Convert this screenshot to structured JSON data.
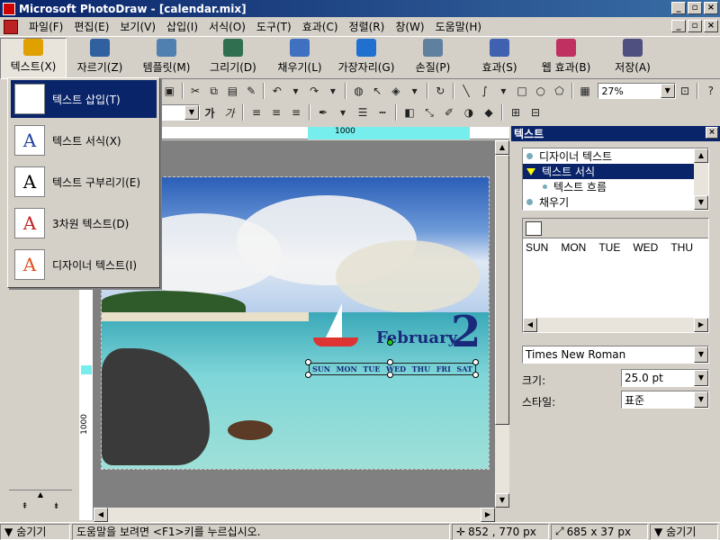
{
  "window": {
    "title": "Microsoft PhotoDraw - [calendar.mix]",
    "min": "_",
    "max": "▫",
    "close": "×"
  },
  "menubar": {
    "items": [
      "파일(F)",
      "편집(E)",
      "보기(V)",
      "삽입(I)",
      "서식(O)",
      "도구(T)",
      "효과(C)",
      "정렬(R)",
      "창(W)",
      "도움말(H)"
    ]
  },
  "bigbar": {
    "items": [
      {
        "label": "텍스트(X)",
        "icon": "text-icon",
        "color": "#e0a000"
      },
      {
        "label": "자르기(Z)",
        "icon": "crop-icon",
        "color": "#3060a0"
      },
      {
        "label": "템플릿(M)",
        "icon": "template-icon",
        "color": "#5080b0"
      },
      {
        "label": "그리기(D)",
        "icon": "draw-icon",
        "color": "#307050"
      },
      {
        "label": "채우기(L)",
        "icon": "fill-icon",
        "color": "#4070c0"
      },
      {
        "label": "가장자리(G)",
        "icon": "edge-icon",
        "color": "#2070d0"
      },
      {
        "label": "손질(P)",
        "icon": "touchup-icon",
        "color": "#6080a0"
      },
      {
        "label": "효과(S)",
        "icon": "effects-icon",
        "color": "#4060b0"
      },
      {
        "label": "웹 효과(B)",
        "icon": "web-effects-icon",
        "color": "#c03060"
      },
      {
        "label": "저장(A)",
        "icon": "save-icon",
        "color": "#505080"
      }
    ]
  },
  "toolbar": {
    "zoom": "27%"
  },
  "textmenu": {
    "items": [
      {
        "label": "텍스트 삽입(T)",
        "icon": "insert-text-icon",
        "glyph": "A"
      },
      {
        "label": "텍스트 서식(X)",
        "icon": "format-text-icon",
        "glyph": "A"
      },
      {
        "label": "텍스트 구부리기(E)",
        "icon": "bend-text-icon",
        "glyph": "A"
      },
      {
        "label": "3차원 텍스트(D)",
        "icon": "3d-text-icon",
        "glyph": "A"
      },
      {
        "label": "디자이너 텍스트(I)",
        "icon": "designer-text-icon",
        "glyph": "A"
      }
    ]
  },
  "ruler": {
    "h_mark": "1000",
    "v_mark": "1000"
  },
  "canvas": {
    "month": "February",
    "day": "2",
    "weekdays": [
      "SUN",
      "MON",
      "TUE",
      "WED",
      "THU",
      "FRI",
      "SAT"
    ]
  },
  "panel": {
    "title": "텍스트",
    "tree": [
      {
        "label": "디자이너 텍스트"
      },
      {
        "label": "텍스트 서식"
      },
      {
        "label": "텍스트 흐름"
      },
      {
        "label": "채우기"
      }
    ],
    "text_content": [
      "SUN",
      "MON",
      "TUE",
      "WED",
      "THU"
    ],
    "font": "Times New Roman",
    "size_label": "크기:",
    "size_value": "25.0 pt",
    "style_label": "스타일:",
    "style_value": "표준"
  },
  "status": {
    "left_hide": "숨기기",
    "help": "도움말을 보려면 <F1>키를 누르십시오.",
    "coords": "852 , 770  px",
    "size": "685 x 37  px",
    "right_hide": "숨기기"
  }
}
